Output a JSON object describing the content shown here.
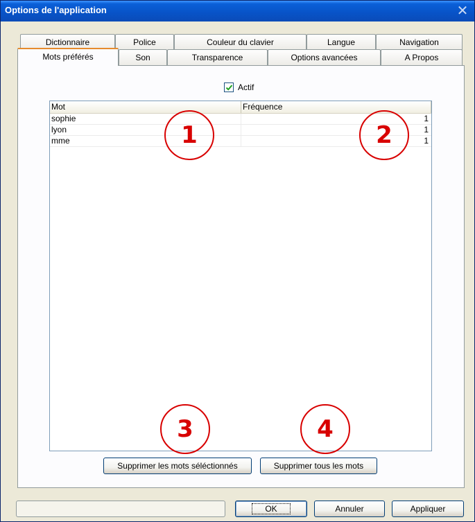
{
  "window": {
    "title": "Options de l'application",
    "close_label": "✕"
  },
  "tabs_row1": [
    "Dictionnaire",
    "Police",
    "Couleur du clavier",
    "Langue",
    "Navigation"
  ],
  "tabs_row2": [
    "Mots préférés",
    "Son",
    "Transparence",
    "Options avancées",
    "A Propos"
  ],
  "active_tab": "Mots préférés",
  "actif": {
    "label": "Actif",
    "checked": true
  },
  "table": {
    "columns": [
      "Mot",
      "Fréquence"
    ],
    "rows": [
      {
        "mot": "sophie",
        "frequence": "1"
      },
      {
        "mot": "lyon",
        "frequence": "1"
      },
      {
        "mot": "mme",
        "frequence": "1"
      }
    ]
  },
  "annotations": [
    "1",
    "2",
    "3",
    "4"
  ],
  "buttons": {
    "delete_selected": "Supprimer les mots séléctionnés",
    "delete_all": "Supprimer tous les mots",
    "ok": "OK",
    "cancel": "Annuler",
    "apply": "Appliquer"
  },
  "colors": {
    "annotation": "#d80000",
    "titlebar": "#0853c7",
    "active_tab_accent": "#e68b2c"
  }
}
